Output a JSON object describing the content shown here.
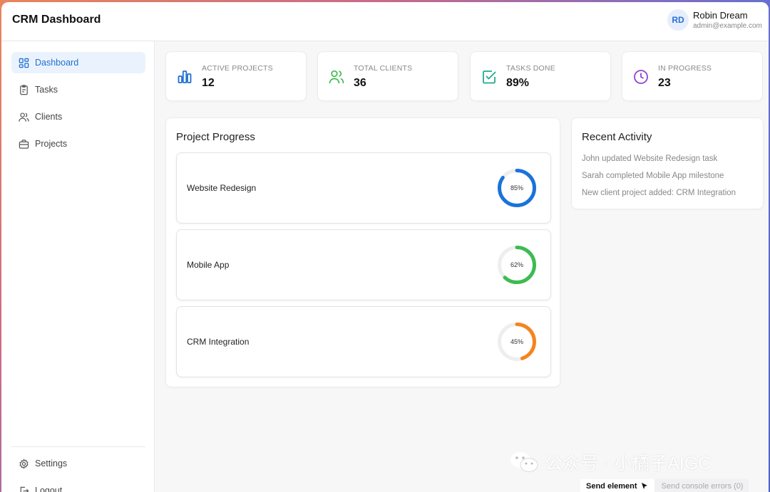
{
  "header": {
    "title": "CRM Dashboard",
    "user": {
      "initials": "RD",
      "name": "Robin Dream",
      "email": "admin@example.com"
    }
  },
  "sidebar": {
    "items": [
      {
        "label": "Dashboard",
        "icon": "dashboard-icon",
        "active": true
      },
      {
        "label": "Tasks",
        "icon": "tasks-icon"
      },
      {
        "label": "Clients",
        "icon": "clients-icon"
      },
      {
        "label": "Projects",
        "icon": "briefcase-icon"
      }
    ],
    "bottom_items": [
      {
        "label": "Settings",
        "icon": "gear-icon"
      },
      {
        "label": "Logout",
        "icon": "logout-icon"
      }
    ]
  },
  "stats": [
    {
      "label": "ACTIVE PROJECTS",
      "value": "12",
      "icon": "bar-chart-icon",
      "color": "#1f6fcf"
    },
    {
      "label": "TOTAL CLIENTS",
      "value": "36",
      "icon": "users-icon",
      "color": "#3fb950"
    },
    {
      "label": "TASKS DONE",
      "value": "89%",
      "icon": "checkbox-icon",
      "color": "#23a88f"
    },
    {
      "label": "IN PROGRESS",
      "value": "23",
      "icon": "clock-icon",
      "color": "#8e44d1"
    }
  ],
  "project_progress": {
    "title": "Project Progress",
    "projects": [
      {
        "name": "Website Redesign",
        "percent": 85,
        "percent_label": "85%",
        "color": "#1a73d9"
      },
      {
        "name": "Mobile App",
        "percent": 62,
        "percent_label": "62%",
        "color": "#3dbb52"
      },
      {
        "name": "CRM Integration",
        "percent": 45,
        "percent_label": "45%",
        "color": "#f5841f"
      }
    ]
  },
  "recent_activity": {
    "title": "Recent Activity",
    "items": [
      "John updated Website Redesign task",
      "Sarah completed Mobile App milestone",
      "New client project added: CRM Integration"
    ]
  },
  "watermark": {
    "text": "公众号 · 小橘子AIGC"
  },
  "devtools": {
    "send_element": "Send element",
    "send_errors": "Send console errors (0)"
  }
}
